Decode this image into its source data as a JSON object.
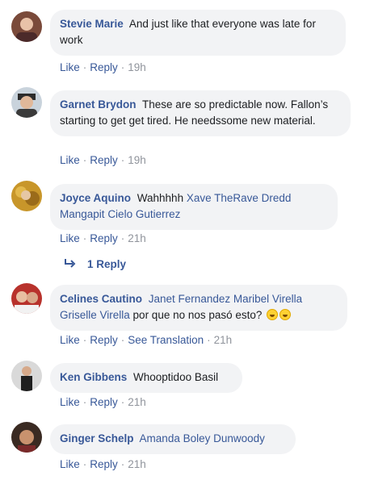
{
  "comments": [
    {
      "name": "Stevie Marie",
      "text": "And just like that everyone was late for work",
      "actions": {
        "like": "Like",
        "reply": "Reply",
        "time": "19h"
      }
    },
    {
      "name": "Garnet Brydon",
      "text": "These are so predictable now. Fallon’s starting to get get tired. He needssome new material.",
      "actions": {
        "like": "Like",
        "reply": "Reply",
        "time": "19h"
      }
    },
    {
      "name": "Joyce Aquino",
      "text": "Wahhhhh",
      "tags": [
        "Xave TheRave Dredd",
        "Mangapit",
        "Cielo Gutierrez"
      ],
      "actions": {
        "like": "Like",
        "reply": "Reply",
        "time": "21h"
      },
      "replies_label": "1 Reply"
    },
    {
      "name": "Celines Cautino",
      "tags": [
        "Janet Fernandez",
        "Maribel Virella",
        "Griselle Virella"
      ],
      "text": "por que no nos pasó esto?",
      "emoji": "laughing-emoji",
      "actions": {
        "like": "Like",
        "reply": "Reply",
        "translate": "See Translation",
        "time": "21h"
      }
    },
    {
      "name": "Ken Gibbens",
      "text": "Whooptidoo Basil",
      "actions": {
        "like": "Like",
        "reply": "Reply",
        "time": "21h"
      }
    },
    {
      "name": "Ginger Schelp",
      "tags": [
        "Amanda Boley Dunwoody"
      ],
      "actions": {
        "like": "Like",
        "reply": "Reply",
        "time": "21h"
      }
    }
  ],
  "icons": {
    "reply_arrow": "reply-arrow-icon"
  },
  "colors": {
    "link": "#385898",
    "bubble": "#f2f3f5",
    "meta": "#90949c"
  }
}
